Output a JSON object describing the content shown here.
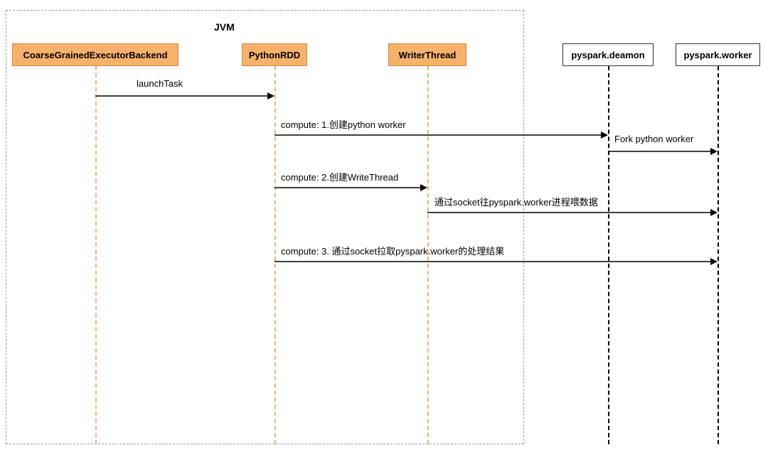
{
  "jvm_label": "JVM",
  "participants": {
    "p1": "CoarseGrainedExecutorBackend",
    "p2": "PythonRDD",
    "p3": "WriterThread",
    "p4": "pyspark.deamon",
    "p5": "pyspark.worker"
  },
  "messages": {
    "m1": "launchTask",
    "m2": "compute: 1.创建python worker",
    "m3": "Fork python worker",
    "m4": "compute: 2.创建WriteThread",
    "m5": "通过socket往pyspark.worker进程喂数据",
    "m6": "compute: 3. 通过socket拉取pyspark.worker的处理结果"
  }
}
